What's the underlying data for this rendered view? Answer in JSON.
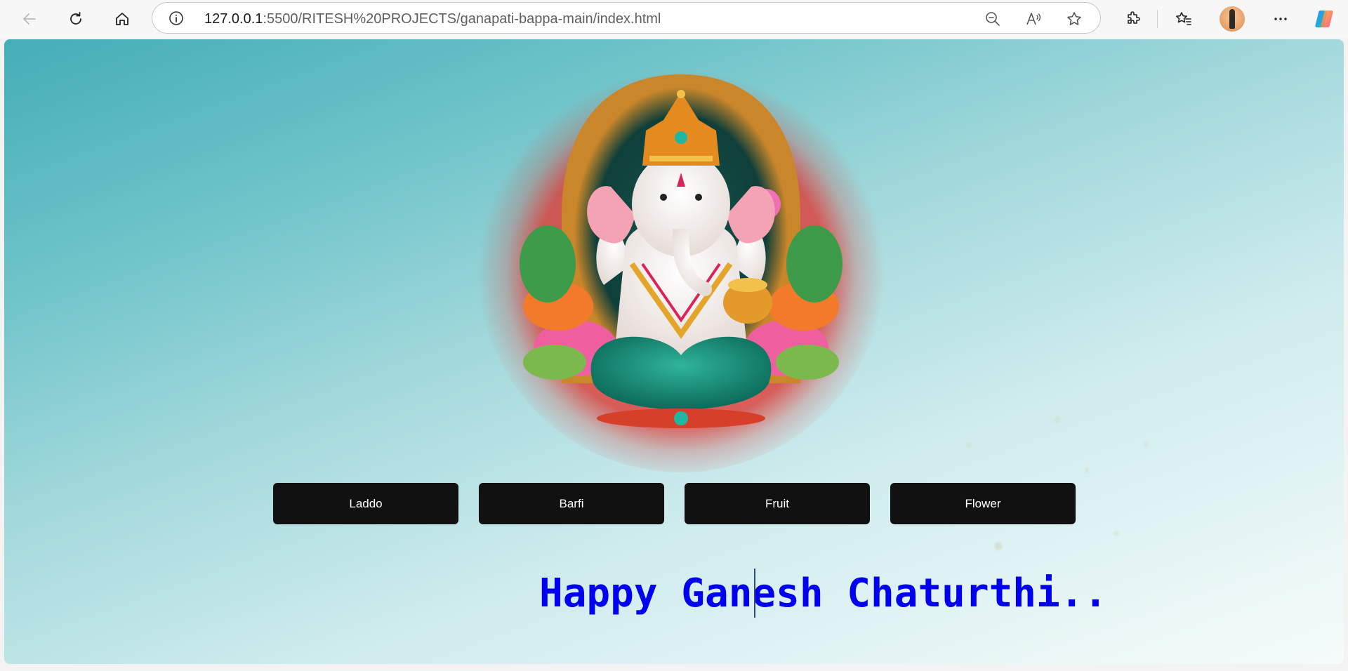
{
  "browser": {
    "url_host": "127.0.0.1",
    "url_path": ":5500/RITESH%20PROJECTS/ganapati-bappa-main/index.html",
    "icons": {
      "back": "back-arrow-icon",
      "reload": "reload-icon",
      "home": "home-icon",
      "info": "info-icon",
      "zoom": "zoom-out-icon",
      "read_aloud": "read-aloud-icon",
      "favorite": "star-icon",
      "extensions": "puzzle-icon",
      "favorites_bar": "favorites-icon",
      "profile": "avatar",
      "more": "more-icon",
      "copilot": "copilot-icon"
    }
  },
  "page": {
    "offerings": [
      {
        "label": "Laddo"
      },
      {
        "label": "Barfi"
      },
      {
        "label": "Fruit"
      },
      {
        "label": "Flower"
      }
    ],
    "greeting": "Happy Ganesh Chaturthi..",
    "colors": {
      "button_bg": "#111111",
      "button_text": "#ffffff",
      "greeting_text": "#0000f0",
      "background_start": "#45adb7",
      "background_end": "#f6fbfb"
    }
  }
}
